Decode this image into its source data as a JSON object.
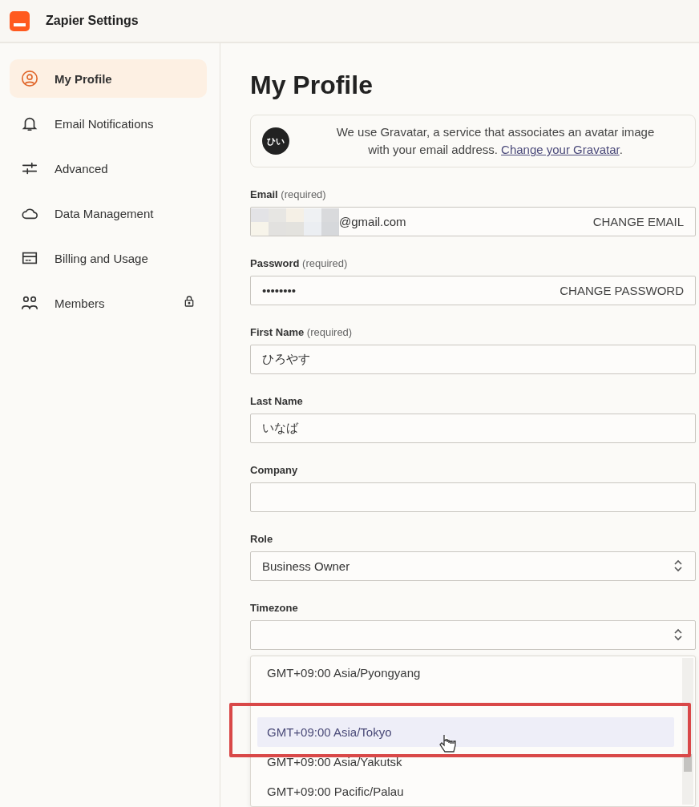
{
  "header": {
    "title": "Zapier Settings"
  },
  "sidebar": {
    "items": [
      {
        "label": "My Profile",
        "selected": true,
        "locked": false
      },
      {
        "label": "Email Notifications",
        "selected": false,
        "locked": false
      },
      {
        "label": "Advanced",
        "selected": false,
        "locked": false
      },
      {
        "label": "Data Management",
        "selected": false,
        "locked": false
      },
      {
        "label": "Billing and Usage",
        "selected": false,
        "locked": false
      },
      {
        "label": "Members",
        "selected": false,
        "locked": true
      }
    ]
  },
  "page": {
    "title": "My Profile"
  },
  "gravatar": {
    "avatar": "ひい",
    "text": "We use Gravatar, a service that associates an avatar image with your email address.",
    "link": "Change your Gravatar",
    "after": "."
  },
  "fields": [
    {
      "kind": "action",
      "label": "Email",
      "note": "(required)",
      "value": "@gmail.com",
      "redacted": true,
      "action": "CHANGE EMAIL"
    },
    {
      "kind": "action",
      "label": "Password",
      "note": "(required)",
      "value": "••••••••",
      "redacted": false,
      "action": "CHANGE PASSWORD"
    },
    {
      "kind": "text",
      "label": "First Name",
      "note": "(required)",
      "value": "ひろやす"
    },
    {
      "kind": "text",
      "label": "Last Name",
      "value": "いなば"
    },
    {
      "kind": "text",
      "label": "Company"
    },
    {
      "kind": "select",
      "label": "Role",
      "value": "Business Owner"
    },
    {
      "kind": "select",
      "label": "Timezone"
    }
  ],
  "timezone_options": [
    {
      "label": "GMT+09:00 Asia/Pyongyang",
      "selected": false
    },
    {
      "selected": false
    },
    {
      "label": "GMT+09:00 Asia/Tokyo",
      "selected": true
    },
    {
      "label": "GMT+09:00 Asia/Yakutsk",
      "selected": false
    },
    {
      "label": "GMT+09:00 Pacific/Palau",
      "selected": false
    }
  ]
}
